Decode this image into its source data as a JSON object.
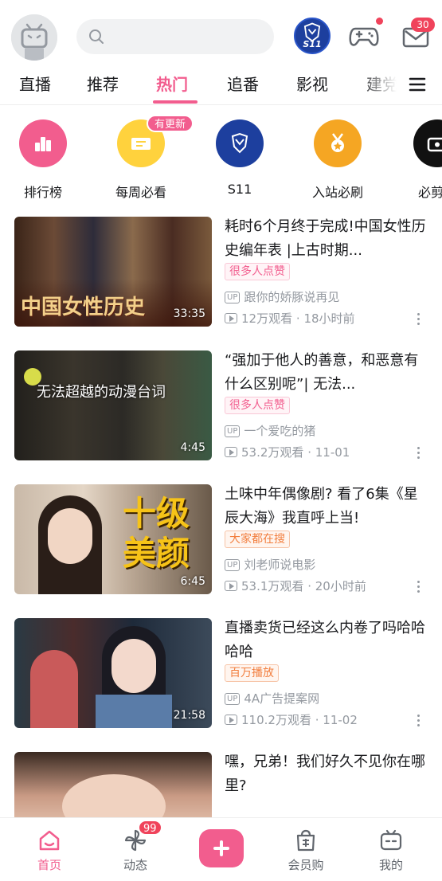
{
  "header": {
    "search_placeholder": "",
    "event_badge_label": "S11",
    "message_count": "30"
  },
  "tabs": [
    {
      "label": "直播"
    },
    {
      "label": "推荐"
    },
    {
      "label": "热门",
      "active": true
    },
    {
      "label": "追番"
    },
    {
      "label": "影视"
    },
    {
      "label": "建党"
    }
  ],
  "shortcuts": [
    {
      "label": "排行榜",
      "icon": "chart-bars-icon",
      "color": "#f25d8e"
    },
    {
      "label": "每周必看",
      "icon": "ticket-icon",
      "color": "#ffd23d",
      "tag": "有更新"
    },
    {
      "label": "S11",
      "icon": "s11-emblem-icon",
      "color": "#1d3f9e"
    },
    {
      "label": "入站必刷",
      "icon": "medal-icon",
      "color": "#f5a623"
    },
    {
      "label": "必剪拍",
      "icon": "clapper-icon",
      "color": "#111111"
    }
  ],
  "videos": [
    {
      "title": "耗时6个月终于完成!中国女性历史编年表 |上古时期...",
      "duration": "33:35",
      "thumb_caption": "中国女性历史",
      "tag": "很多人点赞",
      "tag_style": "pink",
      "up_label": "UP",
      "uploader": "跟你的娇豚说再见",
      "views": "12万观看",
      "time": "18小时前"
    },
    {
      "title": "“强加于他人的善意，和恶意有什么区别呢”| 无法...",
      "duration": "4:45",
      "thumb_caption": "无法超越的动漫台词",
      "tag": "很多人点赞",
      "tag_style": "pink",
      "up_label": "UP",
      "uploader": "一个爱吃的猪",
      "views": "53.2万观看",
      "time": "11-01"
    },
    {
      "title": "土味中年偶像剧? 看了6集《星辰大海》我直呼上当!",
      "duration": "6:45",
      "thumb_caption": "十级 美颜",
      "tag": "大家都在搜",
      "tag_style": "orange",
      "up_label": "UP",
      "uploader": "刘老师说电影",
      "views": "53.1万观看",
      "time": "20小时前"
    },
    {
      "title": "直播卖货已经这么内卷了吗哈哈哈哈",
      "duration": "21:58",
      "thumb_caption": "",
      "tag": "百万播放",
      "tag_style": "orange",
      "up_label": "UP",
      "uploader": "4A广告提案网",
      "views": "110.2万观看",
      "time": "11-02"
    },
    {
      "title": "嘿，兄弟！我们好久不见你在哪里?",
      "duration": "",
      "thumb_caption": "",
      "tag": "",
      "tag_style": "",
      "up_label": "",
      "uploader": "",
      "views": "",
      "time": ""
    }
  ],
  "separator": "·",
  "bottom_nav": [
    {
      "label": "首页",
      "icon": "home-icon",
      "active": true
    },
    {
      "label": "动态",
      "icon": "pinwheel-icon",
      "badge": "99"
    },
    {
      "label": "",
      "icon": "plus-icon"
    },
    {
      "label": "会员购",
      "icon": "shopping-bag-icon"
    },
    {
      "label": "我的",
      "icon": "tv-icon"
    }
  ],
  "colors": {
    "accent": "#f25d8e",
    "badge": "#f0435b",
    "muted_text": "#9499a0"
  }
}
